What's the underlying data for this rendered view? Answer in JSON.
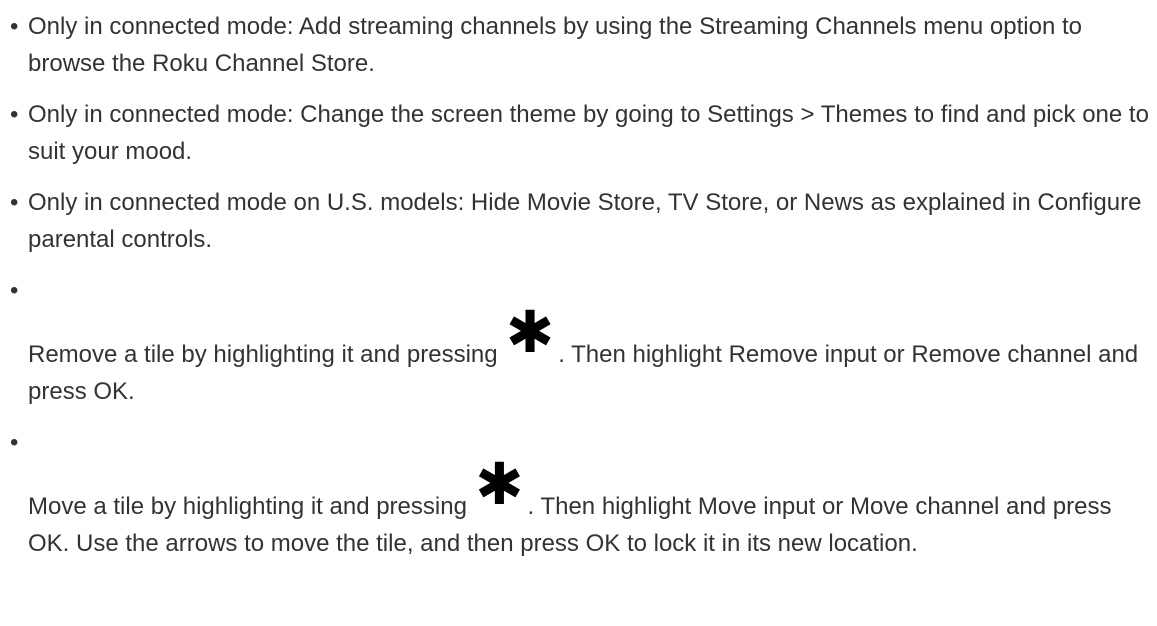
{
  "bullet_glyph": "•",
  "icons": {
    "star": {
      "name": "asterisk-icon",
      "glyph": "✱"
    }
  },
  "items": [
    {
      "text": "Only in connected mode: Add streaming channels by using the Streaming Channels menu option to browse the Roku Channel Store."
    },
    {
      "text": "Only in connected mode: Change the screen theme by going to Settings > Themes to find and pick one to suit your mood."
    },
    {
      "text": "Only in connected mode on U.S. models: Hide Movie Store, TV Store, or News as explained in Configure parental controls."
    },
    {
      "before_icon": "Remove a tile by highlighting it and pressing",
      "after_icon": ". Then highlight Remove input or Remove channel and press OK."
    },
    {
      "before_icon": "Move a tile by highlighting it and pressing",
      "after_icon": ". Then highlight Move input or Move channel and press OK. Use the arrows to move the tile, and then press OK to lock it in its new location."
    }
  ]
}
